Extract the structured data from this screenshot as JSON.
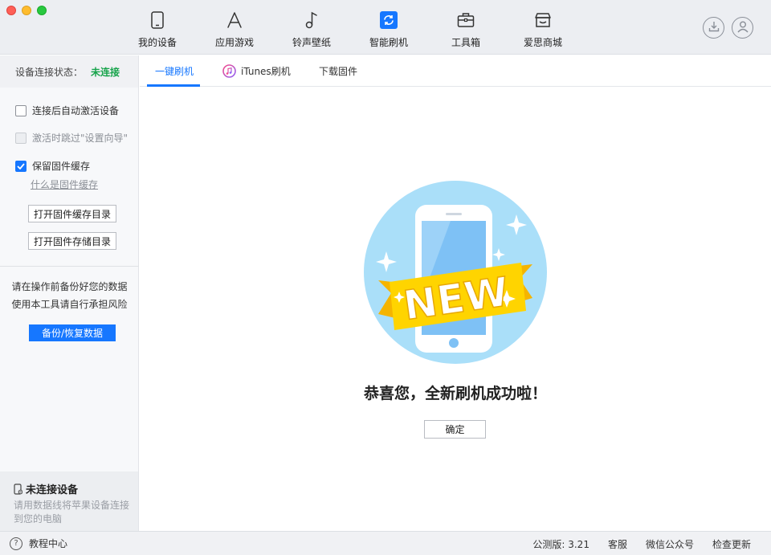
{
  "nav": {
    "items": [
      {
        "label": "我的设备",
        "icon": "phone-icon"
      },
      {
        "label": "应用游戏",
        "icon": "app-store-icon"
      },
      {
        "label": "铃声壁纸",
        "icon": "music-note-icon"
      },
      {
        "label": "智能刷机",
        "icon": "refresh-icon"
      },
      {
        "label": "工具箱",
        "icon": "toolbox-icon"
      },
      {
        "label": "爱思商城",
        "icon": "store-icon"
      }
    ],
    "active_index": 3
  },
  "sidebar": {
    "status_label": "设备连接状态：",
    "status_value": "未连接",
    "options": [
      {
        "label": "连接后自动激活设备",
        "checked": false,
        "disabled": false
      },
      {
        "label": "激活时跳过\"设置向导\"",
        "checked": false,
        "disabled": true
      },
      {
        "label": "保留固件缓存",
        "checked": true,
        "disabled": false
      }
    ],
    "cache_link": "什么是固件缓存",
    "open_cache_dir": "打开固件缓存目录",
    "open_storage_dir": "打开固件存储目录",
    "warning_line1": "请在操作前备份好您的数据",
    "warning_line2": "使用本工具请自行承担风险",
    "backup_button": "备份/恢复数据",
    "device_title": "未连接设备",
    "device_desc": "请用数据线将苹果设备连接到您的电脑"
  },
  "tabs": [
    {
      "label": "一键刷机",
      "active": true
    },
    {
      "label": "iTunes刷机",
      "active": false
    },
    {
      "label": "下载固件",
      "active": false
    }
  ],
  "main": {
    "badge_text": "NEW",
    "success_message": "恭喜您，全新刷机成功啦！",
    "ok_button": "确定"
  },
  "statusbar": {
    "help": "教程中心",
    "version": "公测版: 3.21",
    "service": "客服",
    "wechat": "微信公众号",
    "update": "检查更新"
  },
  "colors": {
    "accent": "#1677ff",
    "status_disconnected": "#16a34a",
    "badge_yellow": "#ffd400",
    "circle_blue": "#a9ddf8"
  }
}
